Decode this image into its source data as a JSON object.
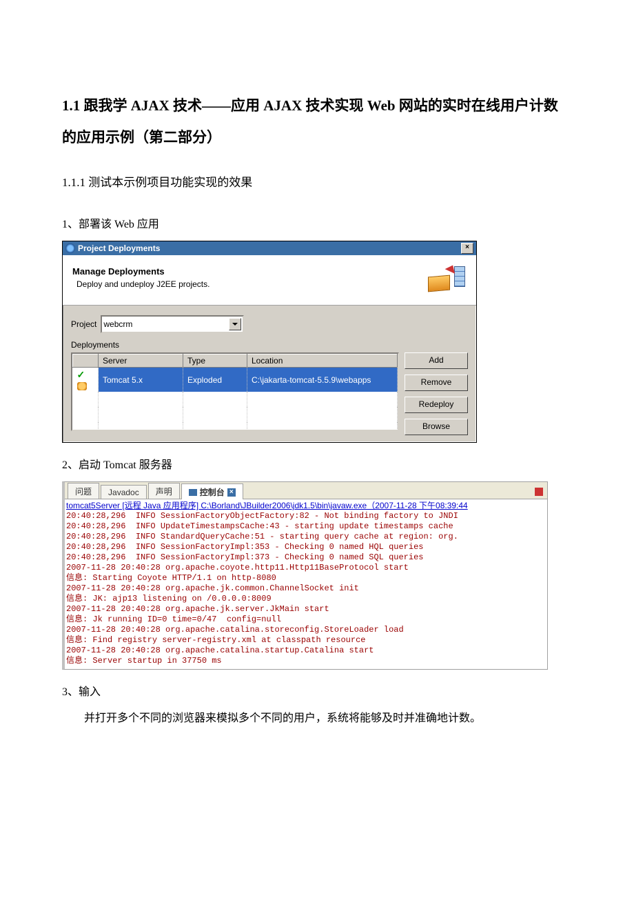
{
  "headings": {
    "h1": "1.1  跟我学 AJAX 技术——应用 AJAX 技术实现 Web 网站的实时在线用户计数的应用示例（第二部分）",
    "h2": "1.1.1 测试本示例项目功能实现的效果",
    "step1": "1、部署该 Web 应用",
    "step2": "2、启动 Tomcat 服务器",
    "step3": "3、输入",
    "para3": "并打开多个不同的浏览器来模拟多个不同的用户，系统将能够及时并准确地计数。"
  },
  "dialog": {
    "title": "Project Deployments",
    "close": "×",
    "header_title": "Manage Deployments",
    "header_sub": "Deploy and undeploy J2EE projects.",
    "project_label": "Project",
    "project_value": "webcrm",
    "deployments_label": "Deployments",
    "columns": {
      "server": "Server",
      "type": "Type",
      "location": "Location"
    },
    "row": {
      "server": "Tomcat  5.x",
      "type": "Exploded",
      "location": "C:\\jakarta-tomcat-5.5.9\\webapps"
    },
    "buttons": {
      "add": "Add",
      "remove": "Remove",
      "redeploy": "Redeploy",
      "browse": "Browse"
    }
  },
  "console": {
    "tabs": {
      "t1": "问题",
      "t2": "Javadoc",
      "t3": "声明",
      "t4": "控制台"
    },
    "termline": "tomcat5Server [远程 Java 应用程序] C:\\Borland\\JBuilder2006\\jdk1.5\\bin\\javaw.exe（2007-11-28 下午08:39:44",
    "lines": [
      "20:40:28,296  INFO SessionFactoryObjectFactory:82 - Not binding factory to JNDI",
      "20:40:28,296  INFO UpdateTimestampsCache:43 - starting update timestamps cache",
      "20:40:28,296  INFO StandardQueryCache:51 - starting query cache at region: org.",
      "20:40:28,296  INFO SessionFactoryImpl:353 - Checking 0 named HQL queries",
      "20:40:28,296  INFO SessionFactoryImpl:373 - Checking 0 named SQL queries",
      "2007-11-28 20:40:28 org.apache.coyote.http11.Http11BaseProtocol start",
      "信息: Starting Coyote HTTP/1.1 on http-8080",
      "2007-11-28 20:40:28 org.apache.jk.common.ChannelSocket init",
      "信息: JK: ajp13 listening on /0.0.0.0:8009",
      "2007-11-28 20:40:28 org.apache.jk.server.JkMain start",
      "信息: Jk running ID=0 time=0/47  config=null",
      "2007-11-28 20:40:28 org.apache.catalina.storeconfig.StoreLoader load",
      "信息: Find registry server-registry.xml at classpath resource",
      "2007-11-28 20:40:28 org.apache.catalina.startup.Catalina start",
      "信息: Server startup in 37750 ms"
    ]
  }
}
